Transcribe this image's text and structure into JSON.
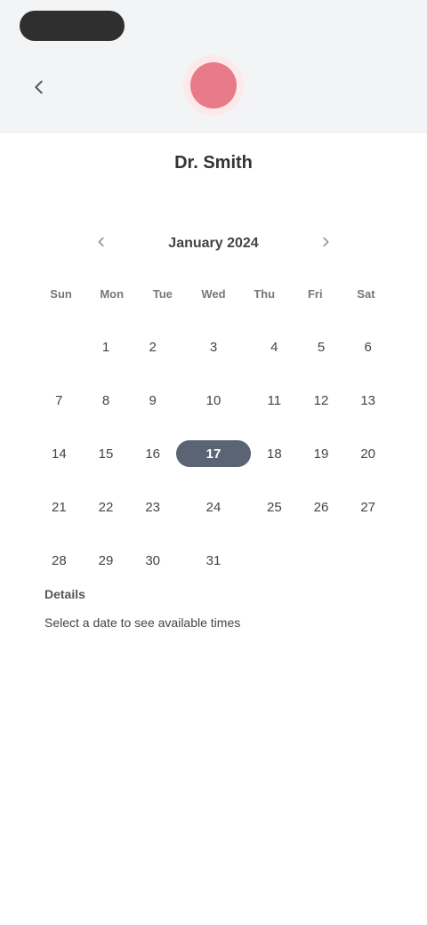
{
  "header": {
    "back_icon": "back-arrow-icon",
    "avatar_color": "#e87b88",
    "profile_name": "Dr. Smith"
  },
  "calendar": {
    "month_label": "January 2024",
    "prev_icon": "chevron-left-icon",
    "next_icon": "chevron-right-icon",
    "weekdays": [
      "Sun",
      "Mon",
      "Tue",
      "Wed",
      "Thu",
      "Fri",
      "Sat"
    ],
    "days": [
      "",
      "1",
      "2",
      "3",
      "4",
      "5",
      "6",
      "7",
      "8",
      "9",
      "10",
      "11",
      "12",
      "13",
      "14",
      "15",
      "16",
      "17",
      "18",
      "19",
      "20",
      "21",
      "22",
      "23",
      "24",
      "25",
      "26",
      "27",
      "28",
      "29",
      "30",
      "31",
      "",
      "",
      ""
    ],
    "selected_day": "17",
    "accent_color": "#5b6472"
  },
  "details": {
    "label": "Details",
    "text": "Select a date to see available times"
  }
}
